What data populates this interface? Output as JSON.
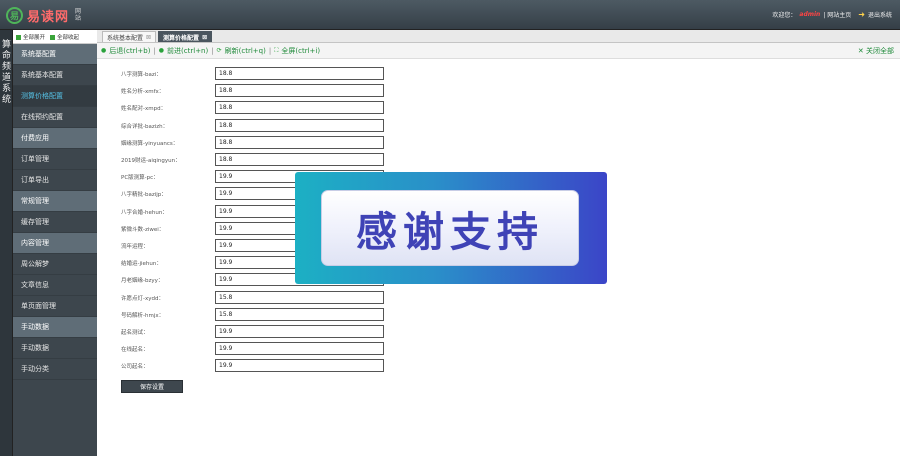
{
  "header": {
    "logo_mark": "易",
    "logo_text": "易读网",
    "logo_sub": [
      "网",
      "站"
    ],
    "welcome": "欢迎您：",
    "username": "admin",
    "site_home": "| 网站主页",
    "logout": "退出系统"
  },
  "channel": {
    "label": "算命频道系统"
  },
  "sidebar": {
    "expand_all": "全部展开",
    "collapse_all": "全部收起",
    "items": [
      {
        "label": "系统基配置",
        "type": "group"
      },
      {
        "label": "系统基本配置",
        "type": "item"
      },
      {
        "label": "测算价格配置",
        "type": "active"
      },
      {
        "label": "在线预约配置",
        "type": "item"
      },
      {
        "label": "付费应用",
        "type": "group"
      },
      {
        "label": "订单管理",
        "type": "item"
      },
      {
        "label": "订单导出",
        "type": "item"
      },
      {
        "label": "常规管理",
        "type": "group"
      },
      {
        "label": "缓存管理",
        "type": "item"
      },
      {
        "label": "内容管理",
        "type": "group"
      },
      {
        "label": "周公解梦",
        "type": "item"
      },
      {
        "label": "文章信息",
        "type": "item"
      },
      {
        "label": "单页面管理",
        "type": "item"
      },
      {
        "label": "手动数据",
        "type": "group"
      },
      {
        "label": "手动数据",
        "type": "item"
      },
      {
        "label": "手动分类",
        "type": "item"
      }
    ]
  },
  "tabs": [
    {
      "label": "系统基本配置",
      "active": false
    },
    {
      "label": "测算价格配置",
      "active": true
    }
  ],
  "toolbar": {
    "back": "后退(ctrl+b)",
    "forward": "前进(ctrl+n)",
    "refresh": "刷新(ctrl+q)",
    "fullscreen": "全屏(ctrl+i)",
    "close_all": "关闭全部"
  },
  "form": {
    "fields": [
      {
        "label": "八字测算-bazi：",
        "value": "18.8"
      },
      {
        "label": "姓名分析-xmfx：",
        "value": "18.8"
      },
      {
        "label": "姓名配对-xmpd：",
        "value": "18.8"
      },
      {
        "label": "综合详批-bazizh：",
        "value": "18.8"
      },
      {
        "label": "姻缘测算-yinyuancs：",
        "value": "18.8"
      },
      {
        "label": "2019财运-aiqingyun：",
        "value": "18.8"
      },
      {
        "label": "PC版测算-pc：",
        "value": "19.9"
      },
      {
        "label": "八字精批-bazijp：",
        "value": "19.9"
      },
      {
        "label": "八字合婚-hehun：",
        "value": "19.9"
      },
      {
        "label": "紫微斗数-ziwei：",
        "value": "19.9"
      },
      {
        "label": "流年运程：",
        "value": "19.9"
      },
      {
        "label": "结婚运-jiehun：",
        "value": "19.9"
      },
      {
        "label": "月老姻缘-bzyy：",
        "value": "19.9"
      },
      {
        "label": "许愿点灯-xydd：",
        "value": "15.8"
      },
      {
        "label": "号码解析-hmjx：",
        "value": "15.8"
      },
      {
        "label": "起名测试：",
        "value": "19.9"
      },
      {
        "label": "在线起名：",
        "value": "19.9"
      },
      {
        "label": "公司起名：",
        "value": "19.9"
      }
    ],
    "save_label": "保存设置"
  },
  "banner": {
    "text": "感谢支持"
  }
}
